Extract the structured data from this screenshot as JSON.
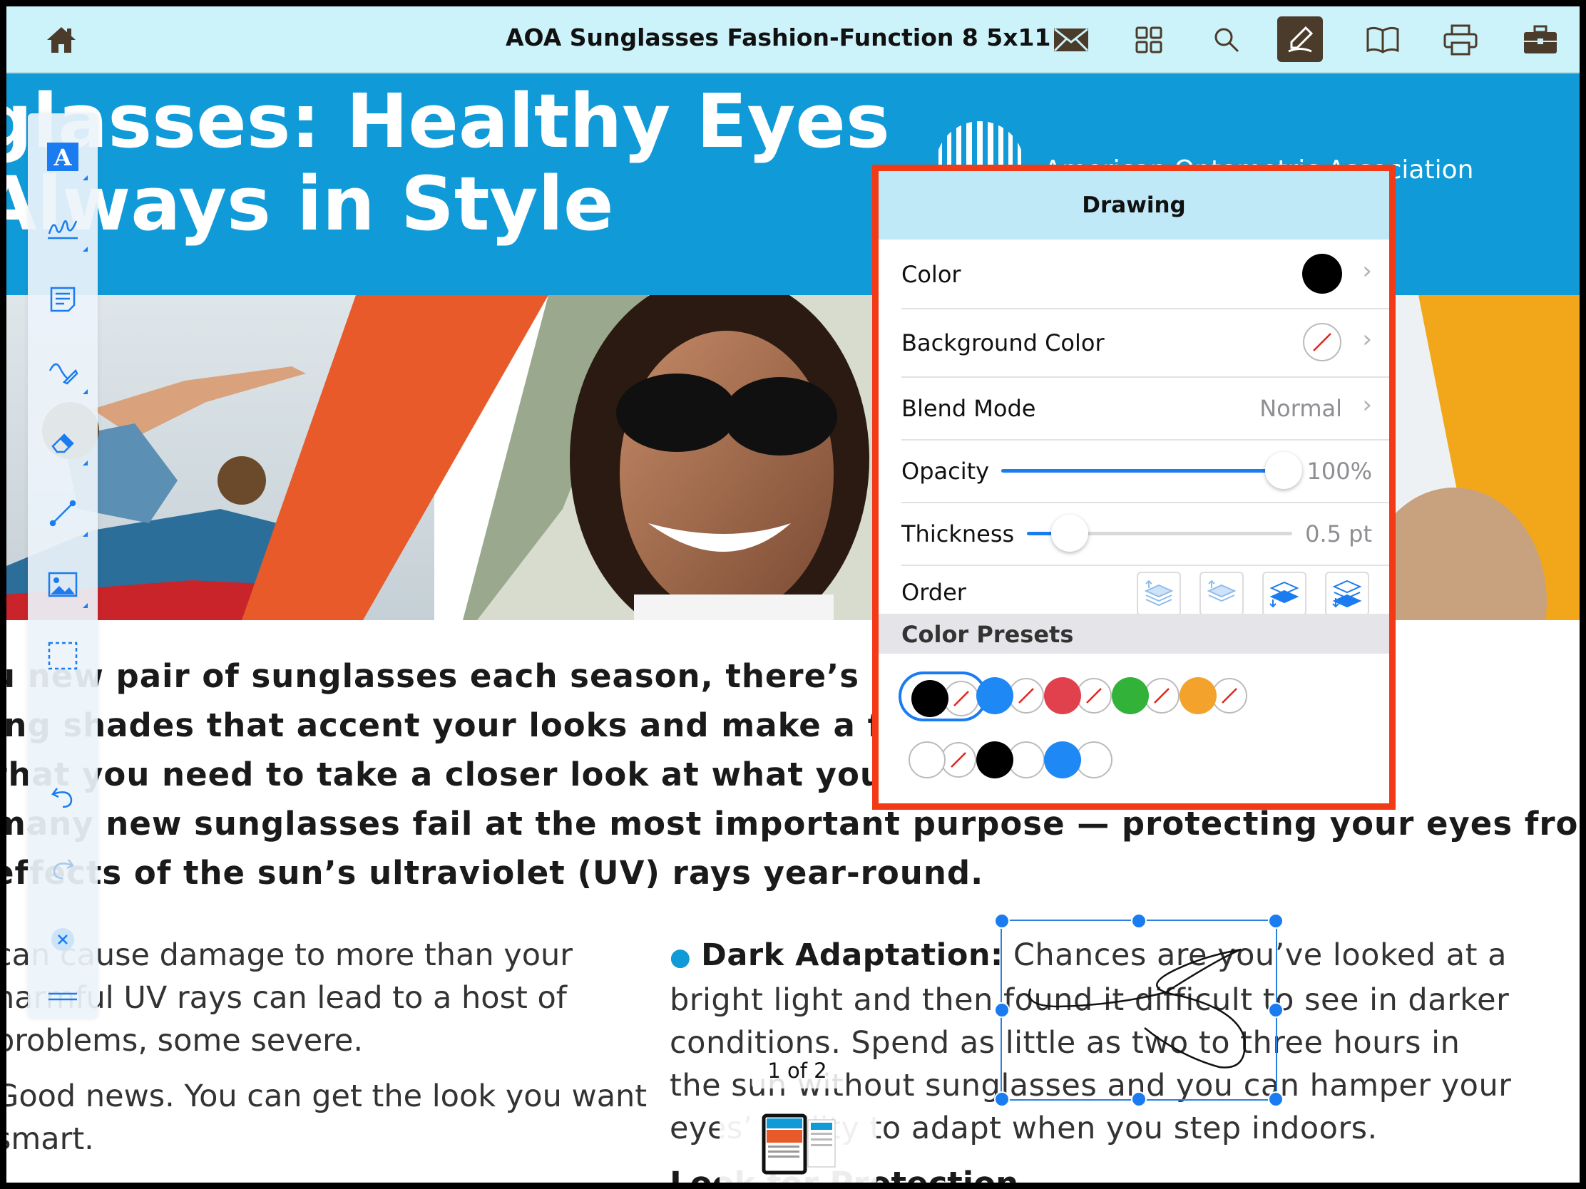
{
  "toolbar": {
    "title": "AOA Sunglasses Fashion-Function 8 5x11",
    "icons": [
      "home-icon",
      "mail-icon",
      "grid-icon",
      "search-icon",
      "annotate-pen-icon",
      "book-icon",
      "print-icon",
      "briefcase-icon"
    ]
  },
  "doc": {
    "headline_1": "glasses: Healthy Eyes",
    "headline_2": "Always in Style",
    "logo_text": "American Optometric Association",
    "intro": [
      "u new pair of sunglasses each season, there’s a good thing",
      "ing shades that accent your looks and make a fashion thing",
      "that you need to take a closer look at what you’re buying. Little",
      "many new sunglasses fail at the most important purpose — protecting your eyes from the",
      "effects of the sun’s ultraviolet (UV) rays year-round."
    ],
    "left_col": [
      [
        "can cause damage to more than your",
        "harmful UV rays can lead to a host of",
        "problems, some severe."
      ],
      [
        "Good news. You can get the look you want",
        "smart."
      ]
    ],
    "right_col": {
      "bullet_title": "Dark Adaptation:",
      "lines": [
        " Chances are you’ve looked at a",
        "bright light and then found it difficult to see in darker",
        "conditions. Spend as little as two to three hours in",
        "the sun without sunglasses and you can hamper your",
        "eyes’ ability to adapt when you step indoors."
      ],
      "next_heading": "Look for Protection"
    }
  },
  "left_tools": [
    "text-tool-icon",
    "signature-tool-icon",
    "note-tool-icon",
    "pen-tool-icon",
    "eraser-tool-icon",
    "line-tool-icon",
    "image-tool-icon",
    "selection-tool-icon",
    "undo-icon",
    "redo-icon",
    "close-icon",
    "grab-handle-icon"
  ],
  "drawing_panel": {
    "title": "Drawing",
    "color_label": "Color",
    "color_value": "#000000",
    "bg_color_label": "Background Color",
    "blend_label": "Blend Mode",
    "blend_value": "Normal",
    "opacity_label": "Opacity",
    "opacity_value": "100%",
    "opacity_fraction": 1.0,
    "thickness_label": "Thickness",
    "thickness_value": "0.5 pt",
    "thickness_fraction": 0.16,
    "order_label": "Order",
    "order_buttons": [
      "bring-forward-icon",
      "bring-to-front-icon",
      "send-backward-icon",
      "send-to-back-icon"
    ],
    "presets_label": "Color Presets",
    "presets": [
      {
        "fg": "#000000",
        "bg": "none",
        "selected": true
      },
      {
        "fg": "#1e88f5",
        "bg": "none",
        "selected": false
      },
      {
        "fg": "#e0414c",
        "bg": "none",
        "selected": false
      },
      {
        "fg": "#33b23a",
        "bg": "none",
        "selected": false
      },
      {
        "fg": "#f3a22c",
        "bg": "none",
        "selected": false
      },
      {
        "fg": "#ffffff",
        "bg": "none",
        "selected": false
      },
      {
        "fg": "#000000",
        "bg": "#ffffff",
        "selected": false
      },
      {
        "fg": "#1e88f5",
        "bg": "#ffffff",
        "selected": false
      }
    ]
  },
  "page_indicator": "1 of 2",
  "colors": {
    "toolbar_bg": "#cdf3fa",
    "banner": "#109bd8",
    "accent": "#1a7cf0",
    "highlight_border": "#f23a17",
    "orange_stripe": "#e85a2a",
    "yellow_stripe": "#f2a71b"
  }
}
